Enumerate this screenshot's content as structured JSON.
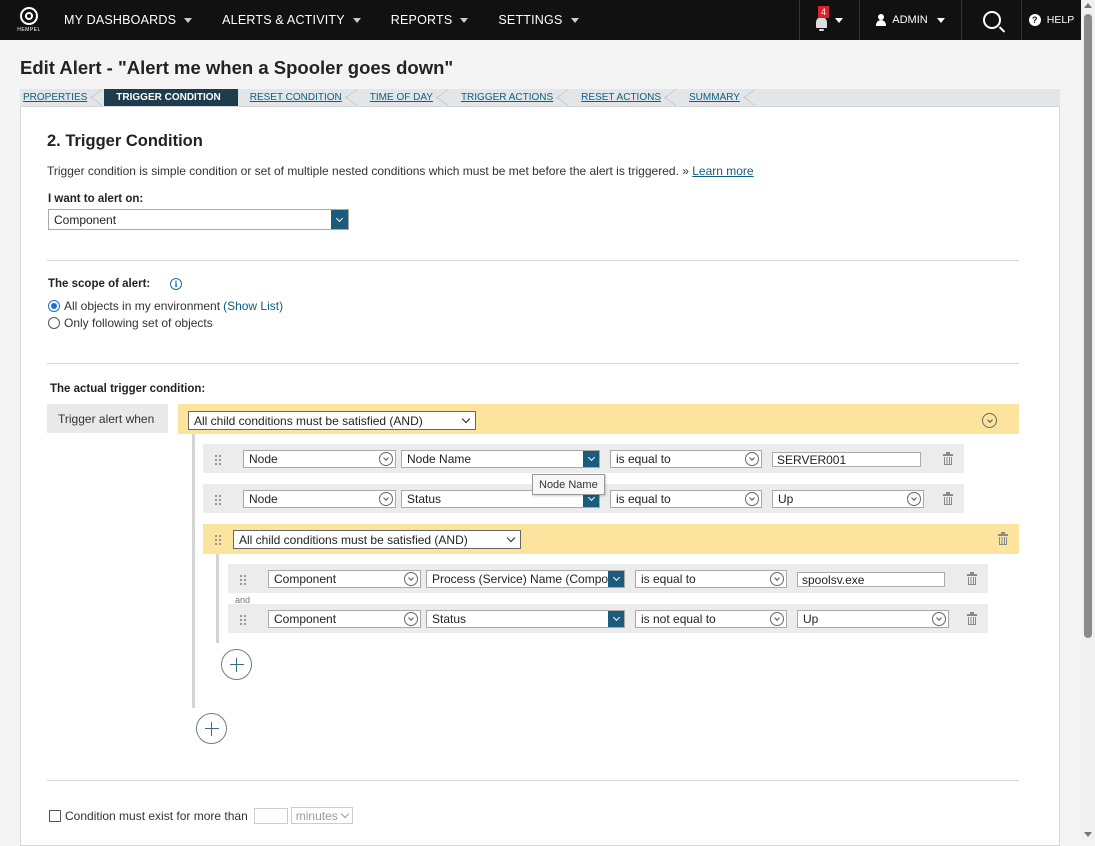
{
  "nav": {
    "logo_text": "HEMPEL",
    "items": [
      "MY DASHBOARDS",
      "ALERTS & ACTIVITY",
      "REPORTS",
      "SETTINGS"
    ],
    "notification_count": "4",
    "user": "ADMIN",
    "help": "HELP"
  },
  "page": {
    "title": "Edit Alert - \"Alert me when a Spooler goes down\""
  },
  "wizard": {
    "steps": [
      "PROPERTIES",
      "TRIGGER CONDITION",
      "RESET CONDITION",
      "TIME OF DAY",
      "TRIGGER ACTIONS",
      "RESET ACTIONS",
      "SUMMARY"
    ],
    "active_index": 1
  },
  "section": {
    "title": "2. Trigger Condition",
    "description": "Trigger condition is simple condition or set of multiple nested conditions which must be met before the alert is triggered. »",
    "learn_more": "Learn more"
  },
  "alert_on": {
    "label": "I want to alert on:",
    "value": "Component"
  },
  "scope": {
    "label": "The scope of alert:",
    "option_all": "All objects in my environment",
    "show_list": "(Show List)",
    "option_following": "Only following set of objects",
    "selected": "all"
  },
  "trigger": {
    "label": "The actual trigger condition:",
    "when_label": "Trigger alert when",
    "top_group": "All child conditions must be satisfied (AND)",
    "rows": [
      {
        "object": "Node",
        "field": "Node Name",
        "operator": "is equal to",
        "value": "SERVER001"
      },
      {
        "object": "Node",
        "field": "Status",
        "operator": "is equal to",
        "value": "Up"
      }
    ],
    "nested_group": "All child conditions must be satisfied (AND)",
    "nested_rows": [
      {
        "object": "Component",
        "field": "Process (Service) Name (Component)",
        "operator": "is equal to",
        "value": "spoolsv.exe"
      },
      {
        "object": "Component",
        "field": "Status",
        "operator": "is not equal to",
        "value": "Up"
      }
    ],
    "and_label": "and",
    "tooltip": "Node Name"
  },
  "duration": {
    "label": "Condition must exist for more than",
    "value": "",
    "unit": "minutes"
  }
}
